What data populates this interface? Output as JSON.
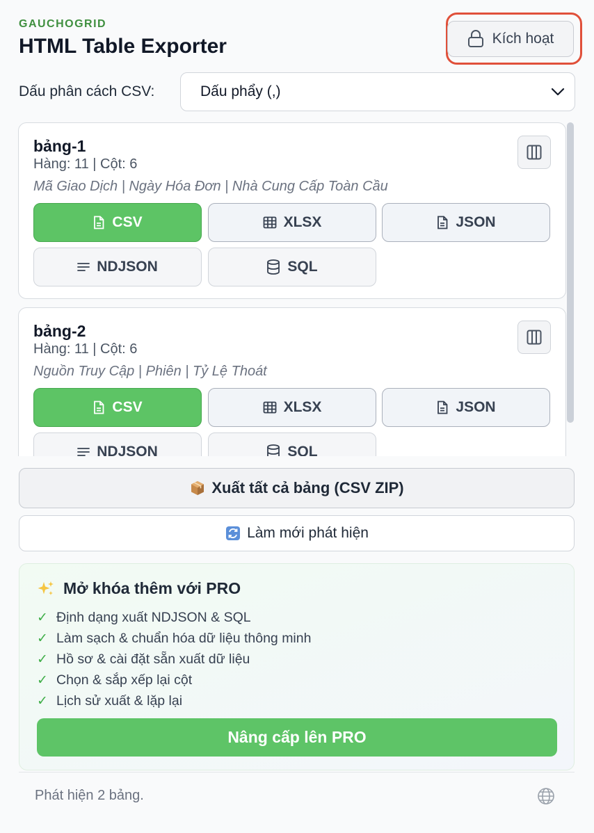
{
  "header": {
    "brand": "GAUCHOGRID",
    "title": "HTML Table Exporter",
    "activate_label": "Kích hoạt"
  },
  "separator": {
    "label": "Dấu phân cách CSV:",
    "selected": "Dấu phẩy (,)"
  },
  "tables": [
    {
      "name": "bảng-1",
      "meta": "Hàng: 11 | Cột: 6",
      "columns": "Mã Giao Dịch | Ngày Hóa Đơn | Nhà Cung Cấp Toàn Cầu"
    },
    {
      "name": "bảng-2",
      "meta": "Hàng: 11 | Cột: 6",
      "columns": "Nguồn Truy Cập | Phiên | Tỷ Lệ Thoát"
    }
  ],
  "formats": {
    "csv": "CSV",
    "xlsx": "XLSX",
    "json": "JSON",
    "ndjson": "NDJSON",
    "sql": "SQL"
  },
  "actions": {
    "export_all": "Xuất tất cả bảng (CSV ZIP)",
    "refresh": "Làm mới phát hiện"
  },
  "pro": {
    "title": "Mở khóa thêm với PRO",
    "features": [
      "Định dạng xuất NDJSON & SQL",
      "Làm sạch & chuẩn hóa dữ liệu thông minh",
      "Hồ sơ & cài đặt sẵn xuất dữ liệu",
      "Chọn & sắp xếp lại cột",
      "Lịch sử xuất & lặp lại"
    ],
    "upgrade_label": "Nâng cấp lên PRO"
  },
  "status": "Phát hiện 2 bảng.",
  "colors": {
    "brand": "#3f8f3f",
    "primary": "#5dc465",
    "highlight_ring": "#e0503a"
  },
  "icons": [
    "lock-icon",
    "chevron-down-icon",
    "columns-icon",
    "file-icon",
    "table-grid-icon",
    "lines-icon",
    "database-icon",
    "package-emoji-icon",
    "refresh-emoji-icon",
    "sparkles-icon",
    "check-icon",
    "globe-icon"
  ]
}
